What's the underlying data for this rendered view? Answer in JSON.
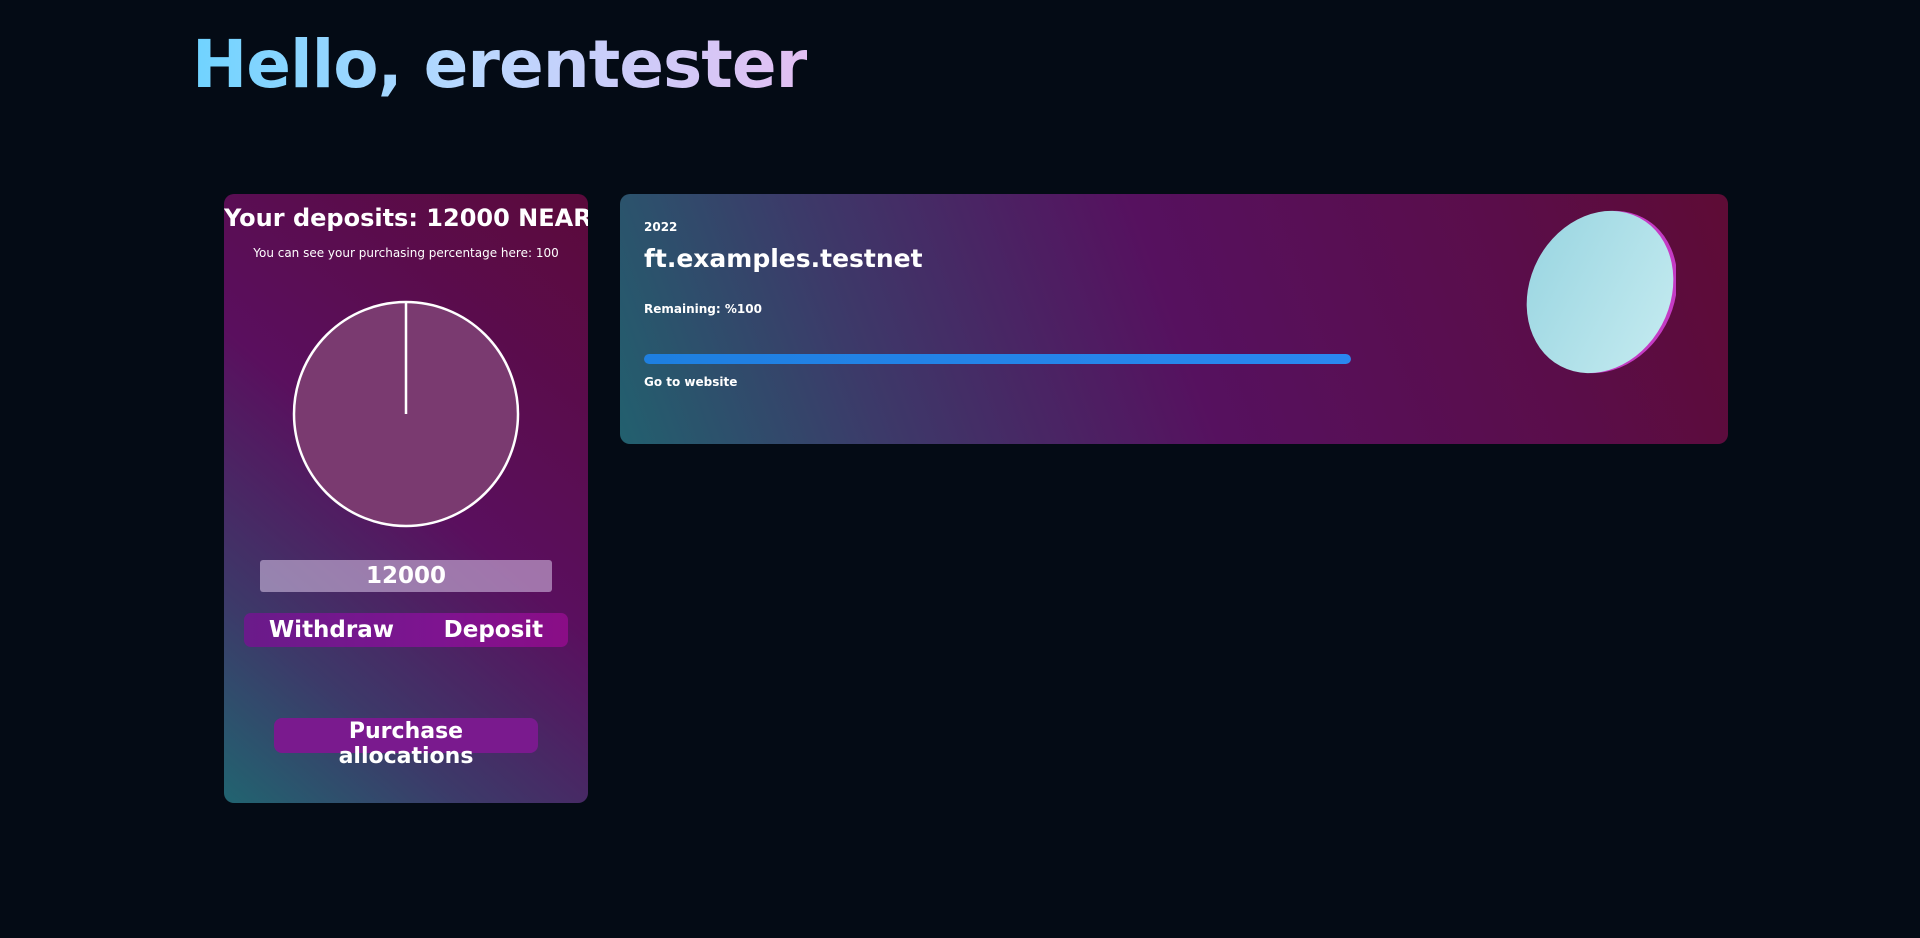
{
  "header": {
    "greeting": "Hello, erentester"
  },
  "deposits": {
    "title": "Your deposits: 12000 NEAR",
    "subtitle": "You can see your purchasing percentage here: 100",
    "pie_percentage": 100,
    "amount_value": "12000",
    "withdraw_label": "Withdraw",
    "deposit_label": "Deposit",
    "purchase_label": "Purchase allocations"
  },
  "project": {
    "year": "2022",
    "name": "ft.examples.testnet",
    "remaining_text": "Remaining: %100",
    "progress_percent": 100,
    "website_label": "Go to website",
    "logo_icon": "ellipse-token-logo"
  },
  "colors": {
    "background": "#040b15",
    "progress": "#1e7fe0",
    "button_purple": "#7a1a8e"
  }
}
